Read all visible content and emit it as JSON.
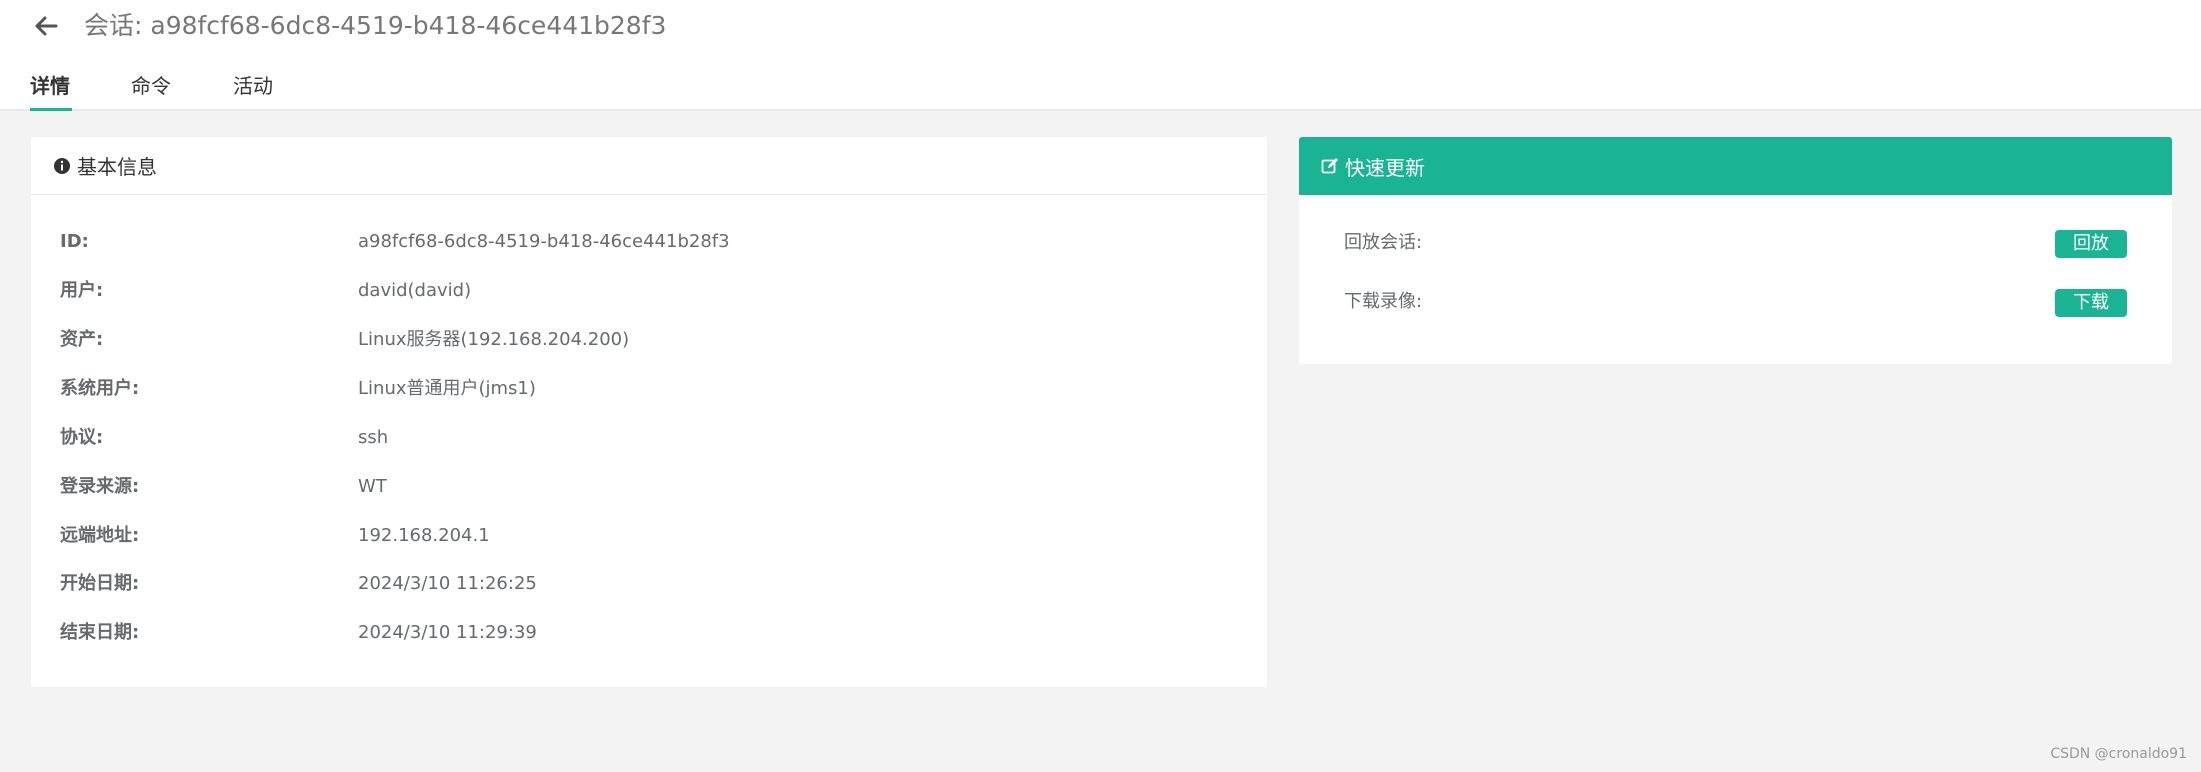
{
  "header": {
    "title": "会话: a98fcf68-6dc8-4519-b418-46ce441b28f3",
    "back_icon": "arrow-left-icon"
  },
  "tabs": [
    {
      "label": "详情",
      "active": true
    },
    {
      "label": "命令",
      "active": false
    },
    {
      "label": "活动",
      "active": false
    }
  ],
  "basic_info": {
    "title": "基本信息",
    "icon": "info-circle-icon",
    "rows": [
      {
        "label": "ID:",
        "value": "a98fcf68-6dc8-4519-b418-46ce441b28f3"
      },
      {
        "label": "用户:",
        "value": "david(david)"
      },
      {
        "label": "资产:",
        "value": "Linux服务器(192.168.204.200)"
      },
      {
        "label": "系统用户:",
        "value": "Linux普通用户(jms1)"
      },
      {
        "label": "协议:",
        "value": "ssh"
      },
      {
        "label": "登录来源:",
        "value": "WT"
      },
      {
        "label": "远端地址:",
        "value": "192.168.204.1"
      },
      {
        "label": "开始日期:",
        "value": "2024/3/10 11:26:25"
      },
      {
        "label": "结束日期:",
        "value": "2024/3/10 11:29:39"
      }
    ]
  },
  "quick_update": {
    "title": "快速更新",
    "icon": "edit-icon",
    "rows": [
      {
        "label": "回放会话:",
        "button": "回放"
      },
      {
        "label": "下载录像:",
        "button": "下载"
      }
    ]
  },
  "colors": {
    "accent": "#1ab394",
    "background": "#f3f3f4"
  },
  "watermark": "CSDN @cronaldo91"
}
